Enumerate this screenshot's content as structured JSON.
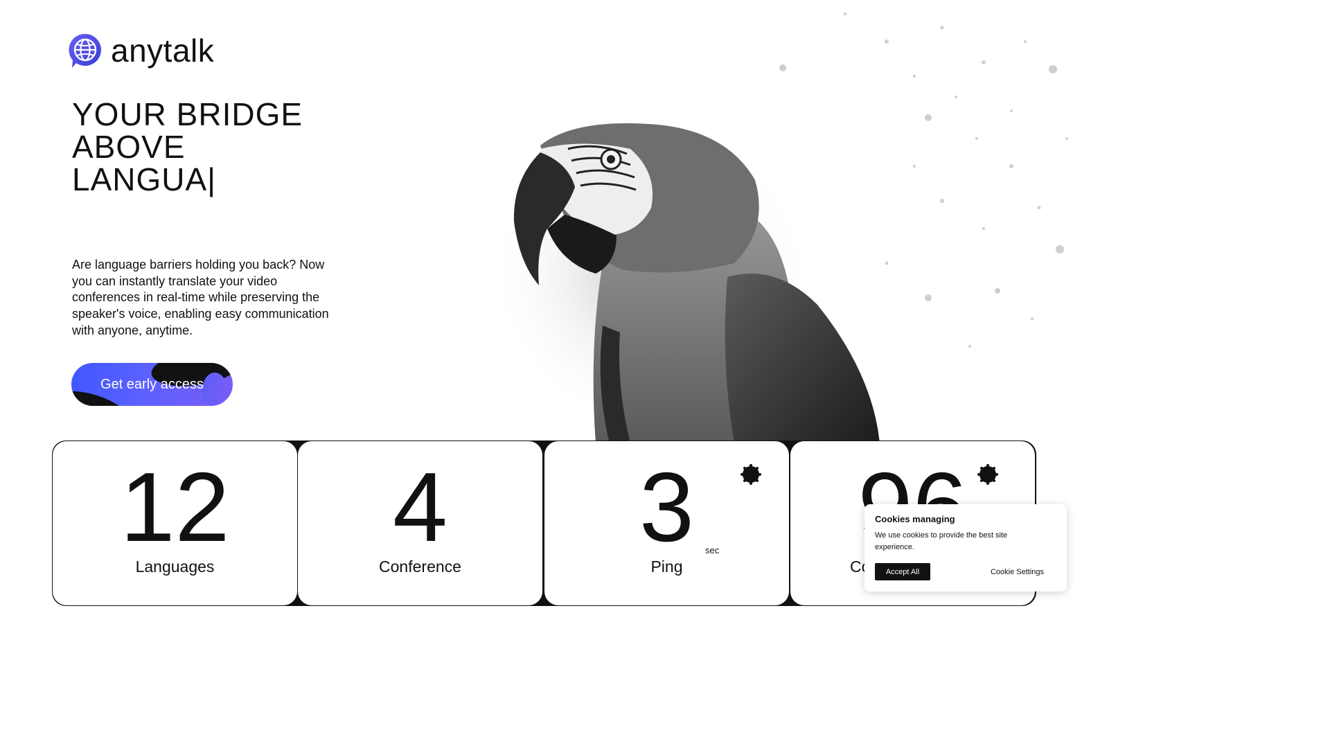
{
  "brand": {
    "name": "anytalk",
    "logo_icon": "globe-chat-icon",
    "accent": "#4a49e8"
  },
  "hero": {
    "title_lines": [
      "YOUR BRIDGE",
      "ABOVE",
      "LANGUA"
    ],
    "caret": "|",
    "description": "Are language barriers holding you back? Now you can instantly translate your video conferences in real-time while preserving the speaker's voice, enabling easy communication with anyone, anytime.",
    "cta_label": "Get early access",
    "image": "parrot-photo"
  },
  "stats": [
    {
      "value": "12",
      "label": "Languages",
      "unit": ""
    },
    {
      "value": "4",
      "label": "Conference",
      "unit": ""
    },
    {
      "value": "3",
      "label": "Ping",
      "unit": "sec"
    },
    {
      "value": "96",
      "label": "Co",
      "unit": ""
    }
  ],
  "cookie_banner": {
    "title": "Cookies managing",
    "text": "We use cookies to provide the best site experience.",
    "accept_label": "Accept All",
    "settings_label": "Cookie Settings"
  }
}
